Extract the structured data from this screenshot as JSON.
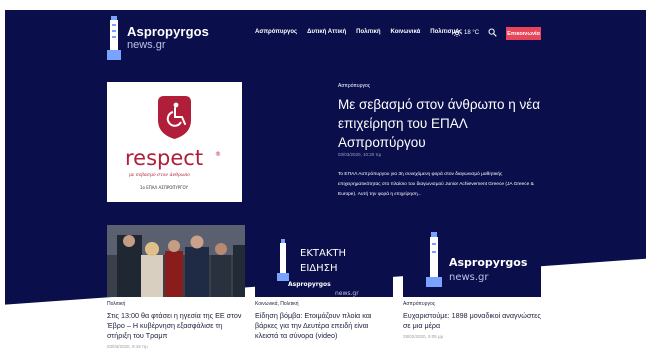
{
  "brand": {
    "name_line1": "Aspropyrgos",
    "name_line2": "news.gr"
  },
  "nav": {
    "items": [
      "Ασπρόπυργος",
      "Δυτική Αττική",
      "Πολιτική",
      "Κοινωνικά",
      "Πολιτισμός"
    ],
    "weather": "18 °C",
    "contact_label": "Επικοινωνία"
  },
  "hero": {
    "category": "Ασπρόπυργος",
    "title": "Με σεβασμό στον άνθρωπο η νέα επιχείρηση του ΕΠΑΛ Ασπροπύργου",
    "date": "03/03/2020, 10:20 πμ",
    "excerpt": "Το ΕΠΑΛ Ασπρόπυργου για 3η συνεχόμενη φορά στον διαγωνισμό μαθητικής επιχειρηματικότητας στο πλαίσιο του διαγωνισμού Junior Achievement Greece (JA Greece & Europe). Αυτή την φορά η επιχείρηση...",
    "image": {
      "word": "respect",
      "registered": "®",
      "tagline": "με σεβασμό στον άνθρωπο",
      "school": "1ο ΕΠΑΛ ΑΣΠΡΟΠΥΡΓΟΥ"
    }
  },
  "cards": [
    {
      "category": "Πολιτική",
      "title": "Στις 13:00 θα φτάσει η ηγεσία της ΕΕ στον Έβρο – Η κυβέρνηση εξασφάλισε τη στήριξη του Τραμπ",
      "date": "03/03/2020, 9:16 πμ"
    },
    {
      "category": "Κοινωνικά, Πολιτική",
      "title": "Είδηση βόμβα: Ετοιμάζουν πλοία και βάρκες για την Δευτέρα επειδή είναι κλειστά τα σύνορα (video)",
      "date": "",
      "image": {
        "line1": "ΕΚΤΑΚΤΗ",
        "line2": "ΕΙΔΗΣΗ",
        "brand1": "Aspropyrgos",
        "brand2": "news.gr"
      }
    },
    {
      "category": "Ασπρόπυργος",
      "title": "Ευχαριστούμε: 1898 μοναδικοί αναγνώστες σε μια μέρα",
      "date": "28/02/2020, 9:05 μμ",
      "image": {
        "brand1": "Aspropyrgos",
        "brand2": "news.gr"
      }
    }
  ],
  "colors": {
    "navy": "#0a0e4a",
    "accent": "#e8445a",
    "respect": "#b01e3a"
  }
}
